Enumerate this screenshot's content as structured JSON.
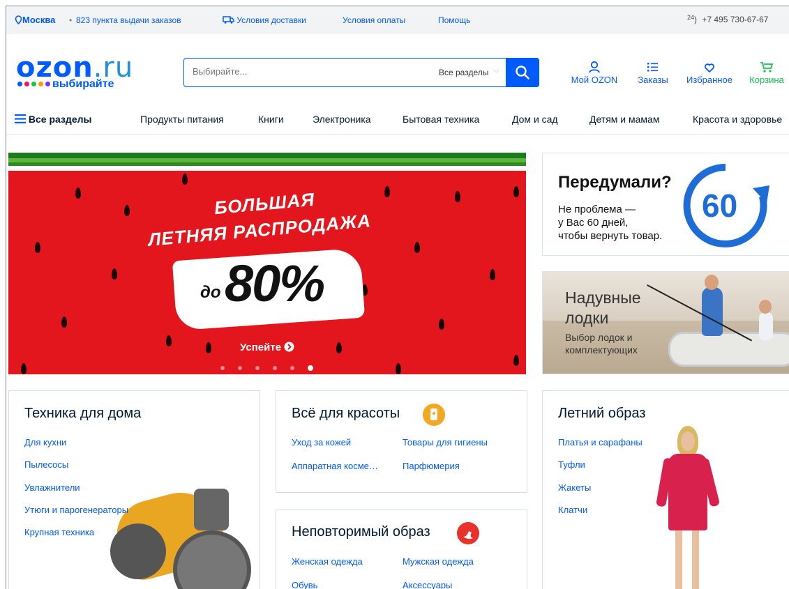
{
  "topbar": {
    "city": "Москва",
    "pickup_points": "823 пункта выдачи заказов",
    "delivery": "Условия доставки",
    "payment": "Условия оплаты",
    "help": "Помощь",
    "phone_badge": "24",
    "phone": "+7 495 730-67-67"
  },
  "header": {
    "logo_main": "ozon",
    "logo_tld": ".ru",
    "logo_tagline": "выбирайте",
    "search_placeholder": "Выбирайте...",
    "search_category": "Все разделы",
    "my_ozon": "Мой OZON",
    "orders": "Заказы",
    "favorites": "Избранное",
    "cart": "Корзина"
  },
  "nav": {
    "all": "Все разделы",
    "items": [
      "Продукты питания",
      "Книги",
      "Электроника",
      "Бытовая техника",
      "Дом и сад",
      "Детям и мамам",
      "Красота и здоровье"
    ]
  },
  "banner": {
    "line1": "БОЛЬШАЯ",
    "line2": "ЛЕТНЯЯ РАСПРОДАЖА",
    "prefix": "до",
    "discount": "80%",
    "cta": "Успейте",
    "slides": 6,
    "active_slide": 6
  },
  "promo_return": {
    "title": "Передумали?",
    "text1": "Не проблема —",
    "text2": "у Вас 60 дней,",
    "text3": "чтобы вернуть товар.",
    "days": "60"
  },
  "promo_boats": {
    "title1": "Надувные",
    "title2": "лодки",
    "sub1": "Выбор лодок и",
    "sub2": "комплектующих"
  },
  "cards": {
    "home_tech": {
      "title": "Техника для дома",
      "links": [
        "Для кухни",
        "Пылесосы",
        "Увлажнители",
        "Утюги и парогенераторы",
        "Крупная техника"
      ]
    },
    "beauty": {
      "title": "Всё для красоты",
      "links": [
        "Уход за кожей",
        "Товары для гигиены",
        "Аппаратная косме…",
        "Парфюмерия"
      ]
    },
    "unique": {
      "title": "Неповторимый образ",
      "links": [
        "Женская одежда",
        "Мужская одежда",
        "Обувь",
        "Аксессуары"
      ]
    },
    "summer": {
      "title": "Летний образ",
      "links": [
        "Платья и сарафаны",
        "Туфли",
        "Жакеты",
        "Клатчи"
      ]
    }
  },
  "colors": {
    "brand_blue": "#005bff",
    "cart_green": "#10c44c",
    "banner_red": "#e3161e",
    "beauty_badge": "#f5a623",
    "unique_badge": "#e8322a"
  }
}
